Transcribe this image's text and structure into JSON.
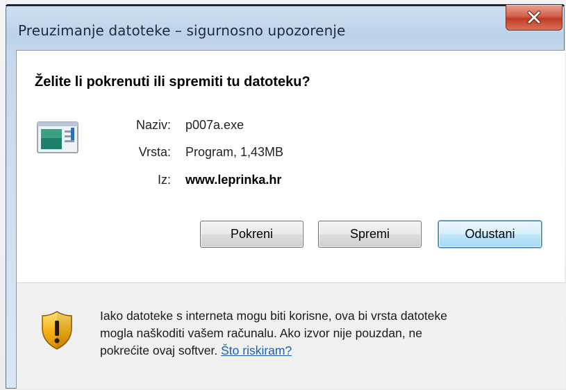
{
  "window": {
    "title": "Preuzimanje datoteke – sigurnosno upozorenje"
  },
  "dialog": {
    "question": "Želite li pokrenuti ili spremiti tu datoteku?",
    "file": {
      "name_label": "Naziv:",
      "name_value": "p007a.exe",
      "type_label": "Vrsta:",
      "type_value": "Program, 1,43MB",
      "from_label": "Iz:",
      "from_value": "www.leprinka.hr"
    },
    "buttons": {
      "run": "Pokreni",
      "save": "Spremi",
      "cancel": "Odustani"
    },
    "warning": {
      "line1": "Iako datoteke s interneta mogu biti korisne, ova bi vrsta datoteke",
      "line2": "mogla naškoditi vašem računalu. Ako izvor nije pouzdan, ne",
      "line3": "pokrećite ovaj softver.",
      "link": "Što riskiram?"
    }
  },
  "icons": {
    "close": "close-icon",
    "file": "program-file-icon",
    "warning": "warning-shield-icon"
  },
  "colors": {
    "link": "#1a5fb4",
    "close_button": "#c23b24",
    "default_button_border": "#3c7fb1"
  }
}
